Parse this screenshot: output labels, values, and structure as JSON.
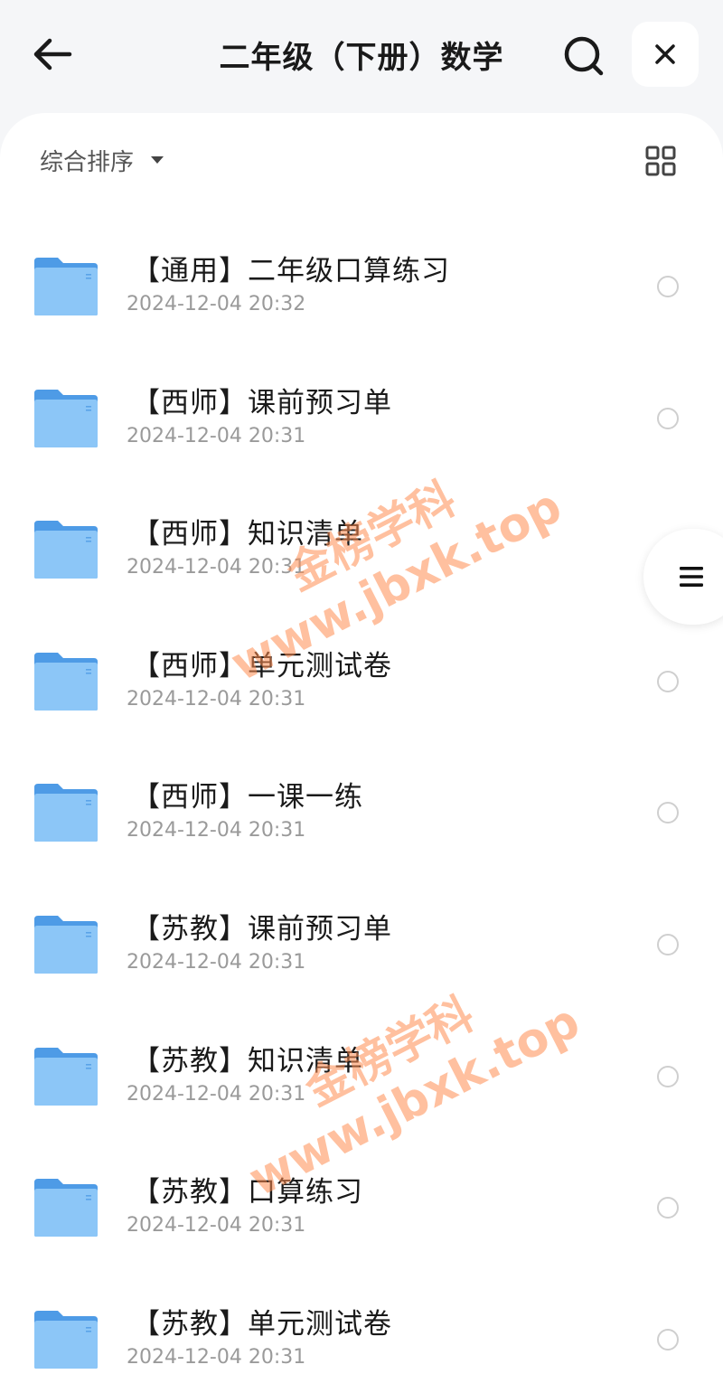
{
  "header": {
    "title": "二年级（下册）数学"
  },
  "toolbar": {
    "sort_label": "综合排序"
  },
  "folders": [
    {
      "name": "【通用】二年级口算练习",
      "date": "2024-12-04 20:32"
    },
    {
      "name": "【西师】课前预习单",
      "date": "2024-12-04 20:31"
    },
    {
      "name": "【西师】知识清单",
      "date": "2024-12-04 20:31"
    },
    {
      "name": "【西师】单元测试卷",
      "date": "2024-12-04 20:31"
    },
    {
      "name": "【西师】一课一练",
      "date": "2024-12-04 20:31"
    },
    {
      "name": "【苏教】课前预习单",
      "date": "2024-12-04 20:31"
    },
    {
      "name": "【苏教】知识清单",
      "date": "2024-12-04 20:31"
    },
    {
      "name": "【苏教】口算练习",
      "date": "2024-12-04 20:31"
    },
    {
      "name": "【苏教】单元测试卷",
      "date": "2024-12-04 20:31"
    }
  ],
  "watermark": {
    "brand": "金榜学科",
    "url": "www.jbxk.top"
  },
  "icons": {
    "back": "arrow-left-icon",
    "search": "search-icon",
    "close": "close-icon",
    "sort_caret": "caret-down-icon",
    "grid_view": "grid-view-icon",
    "folder": "folder-icon",
    "select": "radio-circle-icon",
    "menu": "menu-icon"
  },
  "colors": {
    "folder_blue": "#5fa8ee",
    "watermark": "#ff8c50",
    "text_primary": "#1a1a1a",
    "text_secondary": "#9a9a9a"
  }
}
